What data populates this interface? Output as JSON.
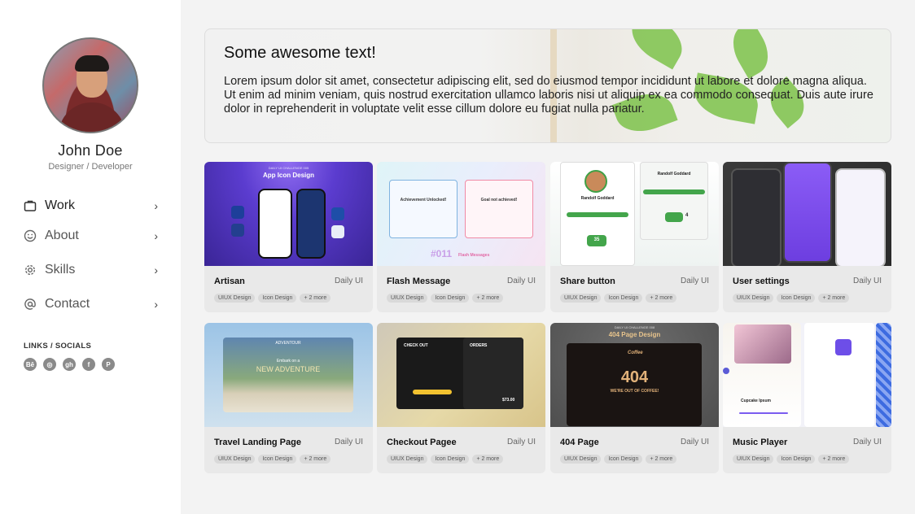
{
  "profile": {
    "name": "John Doe",
    "role": "Designer / Developer"
  },
  "nav": [
    {
      "label": "Work",
      "icon": "briefcase-icon"
    },
    {
      "label": "About",
      "icon": "smile-icon"
    },
    {
      "label": "Skills",
      "icon": "gear-icon"
    },
    {
      "label": "Contact",
      "icon": "at-icon"
    }
  ],
  "links": {
    "title": "LINKS / SOCIALS",
    "items": [
      {
        "name": "behance-icon",
        "glyph": "Bē"
      },
      {
        "name": "dribbble-icon",
        "glyph": "◎"
      },
      {
        "name": "github-icon",
        "glyph": "gh"
      },
      {
        "name": "facebook-icon",
        "glyph": "f"
      },
      {
        "name": "pinterest-icon",
        "glyph": "P"
      }
    ]
  },
  "hero": {
    "title": "Some awesome text!",
    "body": "Lorem ipsum dolor sit amet, consectetur adipiscing elit, sed do eiusmod tempor incididunt ut labore et dolore magna aliqua. Ut enim ad minim veniam, quis nostrud exercitation ullamco laboris nisi ut aliquip ex ea commodo consequat. Duis aute irure dolor in reprehenderit in voluptate velit esse cillum dolore eu fugiat nulla pariatur."
  },
  "projects": [
    {
      "title": "Artisan",
      "category": "Daily UI",
      "tags": [
        "UIUX Design",
        "Icon Design",
        "+ 2 more"
      ],
      "thumb_text": [
        "DAILY UI CHALLENGE 005",
        "App Icon Design"
      ]
    },
    {
      "title": "Flash Message",
      "category": "Daily UI",
      "tags": [
        "UIUX Design",
        "Icon Design",
        "+ 2 more"
      ],
      "thumb_text": [
        "Achievement Unlocked!",
        "Goal not achieved!",
        "#011",
        "Flash Messages"
      ]
    },
    {
      "title": "Share button",
      "category": "Daily UI",
      "tags": [
        "UIUX Design",
        "Icon Design",
        "+ 2 more"
      ],
      "thumb_text": [
        "Randolf Goddard",
        "Randolf Goddard",
        "35",
        "4"
      ]
    },
    {
      "title": "User settings",
      "category": "Daily UI",
      "tags": [
        "UIUX Design",
        "Icon Design",
        "+ 2 more"
      ],
      "thumb_text": []
    },
    {
      "title": "Travel Landing Page",
      "category": "Daily UI",
      "tags": [
        "UIUX Design",
        "Icon Design",
        "+ 2 more"
      ],
      "thumb_text": [
        "ADVENTOUR",
        "Embark on a",
        "NEW ADVENTURE"
      ]
    },
    {
      "title": "Checkout Pagee",
      "category": "Daily UI",
      "tags": [
        "UIUX Design",
        "Icon Design",
        "+ 2 more"
      ],
      "thumb_text": [
        "CHECK OUT",
        "ORDERS",
        "$73.00"
      ]
    },
    {
      "title": "404 Page",
      "category": "Daily UI",
      "tags": [
        "UIUX Design",
        "Icon Design",
        "+ 2 more"
      ],
      "thumb_text": [
        "DAILY UI CHALLENGE 008",
        "404 Page Design",
        "Coffee",
        "404",
        "WE'RE OUT OF COFFEE!"
      ]
    },
    {
      "title": "Music Player",
      "category": "Daily UI",
      "tags": [
        "UIUX Design",
        "Icon Design",
        "+ 2 more"
      ],
      "thumb_text": [
        "Cupcake Ipsum"
      ]
    }
  ],
  "colors": {
    "sidebar_bg": "#ffffff",
    "page_bg": "#f3f3f3",
    "card_bg": "#e9e9e9"
  }
}
